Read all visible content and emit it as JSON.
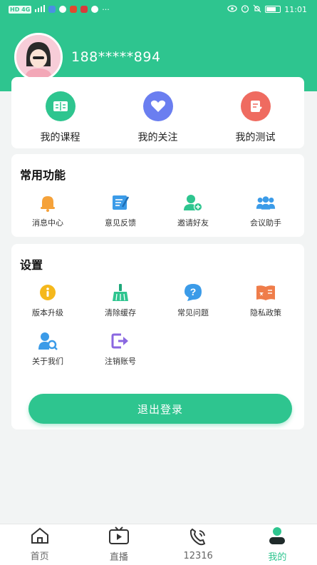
{
  "status_bar": {
    "left_text": "HD 4G",
    "time": "11:01"
  },
  "user": {
    "phone": "188*****894"
  },
  "quick_links": [
    {
      "label": "我的课程",
      "icon": "book-icon",
      "color": "#2ec58f"
    },
    {
      "label": "我的关注",
      "icon": "heart-icon",
      "color": "#6a7ef0"
    },
    {
      "label": "我的测试",
      "icon": "test-icon",
      "color": "#ef6b60"
    }
  ],
  "common": {
    "title": "常用功能",
    "items": [
      {
        "label": "消息中心",
        "icon": "bell-icon",
        "color": "#f5a23a"
      },
      {
        "label": "意见反馈",
        "icon": "feedback-icon",
        "color": "#3b9be8"
      },
      {
        "label": "邀请好友",
        "icon": "invite-user-icon",
        "color": "#2ec58f"
      },
      {
        "label": "会议助手",
        "icon": "meeting-icon",
        "color": "#3b9be8"
      }
    ]
  },
  "settings": {
    "title": "设置",
    "items": [
      {
        "label": "版本升级",
        "icon": "info-icon",
        "color": "#f5b81c"
      },
      {
        "label": "清除缓存",
        "icon": "broom-icon",
        "color": "#2ec58f"
      },
      {
        "label": "常见问题",
        "icon": "question-icon",
        "color": "#3b9be8"
      },
      {
        "label": "隐私政策",
        "icon": "privacy-book-icon",
        "color": "#ef7d4a"
      },
      {
        "label": "关于我们",
        "icon": "about-user-icon",
        "color": "#3b9be8"
      },
      {
        "label": "注销账号",
        "icon": "logout-account-icon",
        "color": "#8a67e0"
      }
    ],
    "logout_label": "退出登录"
  },
  "tabs": [
    {
      "label": "首页",
      "icon": "home-icon"
    },
    {
      "label": "直播",
      "icon": "live-tv-icon"
    },
    {
      "label": "12316",
      "icon": "phone-call-icon"
    },
    {
      "label": "我的",
      "icon": "profile-icon"
    }
  ],
  "colors": {
    "accent": "#2ec58f"
  }
}
